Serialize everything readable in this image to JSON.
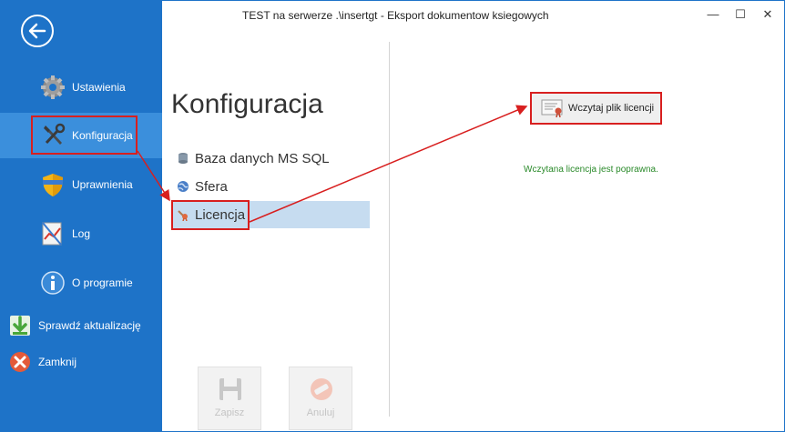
{
  "window": {
    "title": "TEST na serwerze .\\insertgt - Eksport dokumentow ksiegowych",
    "minimize": "—",
    "maximize": "☐",
    "close": "✕"
  },
  "sidebar": {
    "items": [
      {
        "label": "Ustawienia",
        "icon": "gear-icon"
      },
      {
        "label": "Konfiguracja",
        "icon": "wrench-icon"
      },
      {
        "label": "Uprawnienia",
        "icon": "shield-icon"
      },
      {
        "label": "Log",
        "icon": "log-icon"
      },
      {
        "label": "O programie",
        "icon": "info-icon"
      },
      {
        "label": "Sprawdź aktualizację",
        "icon": "download-icon"
      },
      {
        "label": "Zamknij",
        "icon": "close-circle-icon"
      }
    ],
    "active": "Konfiguracja"
  },
  "main": {
    "title": "Konfiguracja",
    "nav": [
      {
        "label": "Baza danych MS SQL",
        "icon": "database-icon"
      },
      {
        "label": "Sfera",
        "icon": "globe-icon"
      },
      {
        "label": "Licencja",
        "icon": "certificate-icon"
      }
    ],
    "selected": "Licencja",
    "buttons": {
      "save": "Zapisz",
      "cancel": "Anuluj"
    }
  },
  "license": {
    "load_button": "Wczytaj plik licencji",
    "status": "Wczytana licencja jest poprawna."
  },
  "colors": {
    "sidebar": "#1e73c8",
    "sidebar_active": "#3b8fdc",
    "nav_selected": "#c6dcf0",
    "highlight": "#d81f1f",
    "status_ok": "#2a8a2a"
  }
}
